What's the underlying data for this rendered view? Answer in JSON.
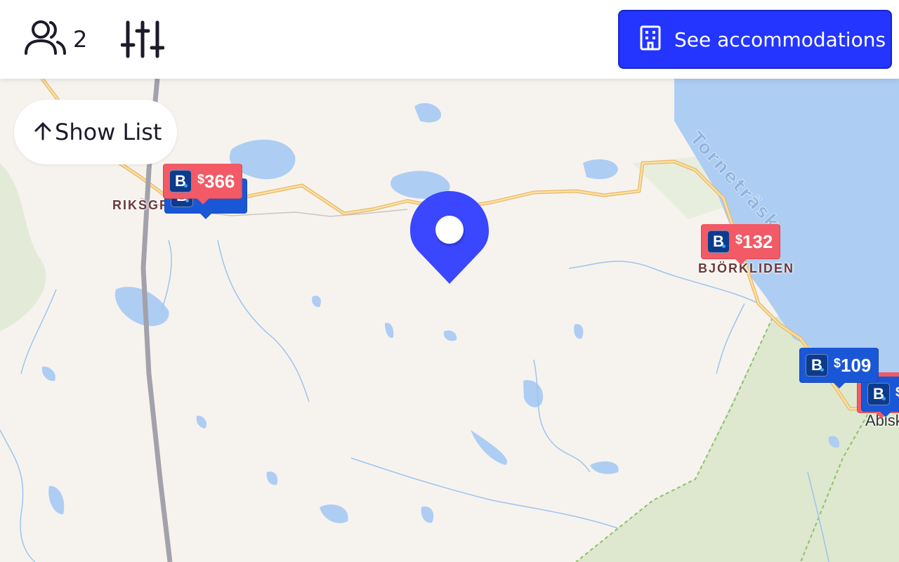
{
  "header": {
    "guests_icon": "users-icon",
    "guests_count": "2",
    "filters_icon": "sliders-icon",
    "cta_icon": "building-icon",
    "cta_label": "See accommodations",
    "accent": "#2335ff"
  },
  "map": {
    "show_list_label": "Show List",
    "show_list_icon": "arrow-up-icon",
    "lake_label": "Torneträsk",
    "places": {
      "riksgransen": "RIKSGR",
      "bjorkliden": "BJÖRKLIDEN",
      "abisko": "Abisk"
    },
    "markers": [
      {
        "currency": "$",
        "amount": "366",
        "color": "red"
      },
      {
        "currency": "$",
        "amount": "132",
        "color": "red"
      },
      {
        "currency": "$",
        "amount": "109",
        "color": "blue"
      },
      {
        "currency": "$",
        "amount": "",
        "color": "blue"
      }
    ],
    "colors": {
      "land": "#f6f3ef",
      "water": "#aecdf3",
      "road": "#f5c97a",
      "railway": "#a3a1ab",
      "park": "#dde8cf",
      "marker_red": "#f25a65",
      "marker_blue": "#1a57d6",
      "pin": "#3b46ff"
    }
  }
}
